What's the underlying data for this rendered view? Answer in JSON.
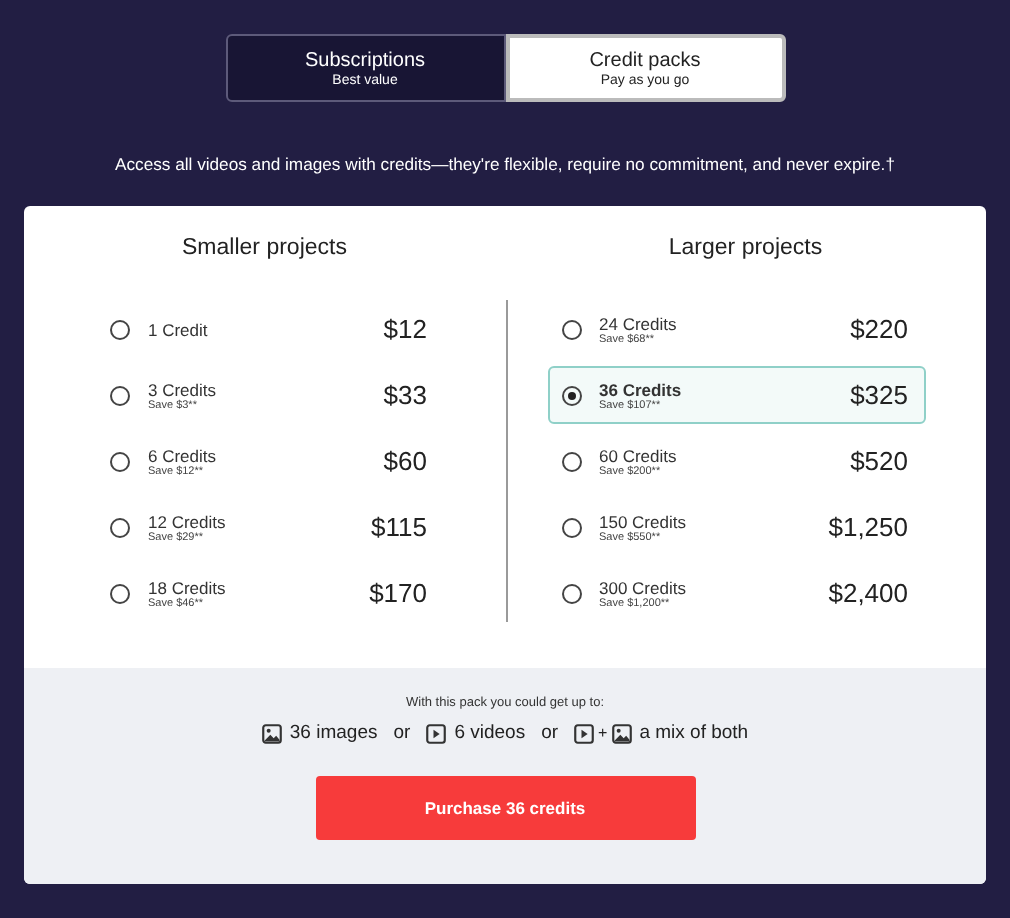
{
  "tabs": [
    {
      "label": "Subscriptions",
      "sublabel": "Best value",
      "selected": false
    },
    {
      "label": "Credit packs",
      "sublabel": "Pay as you go",
      "selected": true
    }
  ],
  "intro": "Access all videos and images with credits—they're flexible, require no commitment, and never expire.†",
  "groups": [
    {
      "title": "Smaller projects",
      "packs": [
        {
          "credits": "1 Credit",
          "price": "$12",
          "selected": false
        },
        {
          "credits": "3 Credits",
          "save": "Save $3**",
          "price": "$33",
          "selected": false
        },
        {
          "credits": "6 Credits",
          "save": "Save $12**",
          "price": "$60",
          "selected": false
        },
        {
          "credits": "12 Credits",
          "save": "Save $29**",
          "price": "$115",
          "selected": false
        },
        {
          "credits": "18 Credits",
          "save": "Save $46**",
          "price": "$170",
          "selected": false
        }
      ]
    },
    {
      "title": "Larger projects",
      "packs": [
        {
          "credits": "24 Credits",
          "save": "Save $68**",
          "price": "$220",
          "selected": false
        },
        {
          "credits": "36 Credits",
          "save": "Save $107**",
          "price": "$325",
          "selected": true
        },
        {
          "credits": "60 Credits",
          "save": "Save $200**",
          "price": "$520",
          "selected": false
        },
        {
          "credits": "150 Credits",
          "save": "Save $550**",
          "price": "$1,250",
          "selected": false
        },
        {
          "credits": "300 Credits",
          "save": "Save $1,200**",
          "price": "$2,400",
          "selected": false
        }
      ]
    }
  ],
  "summary": {
    "heading": "With this pack you could get up to:",
    "options": [
      {
        "kind": "images",
        "text": "36 images"
      },
      {
        "kind": "separator",
        "text": "or"
      },
      {
        "kind": "videos",
        "text": "6 videos"
      },
      {
        "kind": "separator",
        "text": "or"
      },
      {
        "kind": "mix",
        "plus": "+",
        "text": "a mix of both"
      }
    ]
  },
  "purchase_button": "Purchase 36 credits"
}
